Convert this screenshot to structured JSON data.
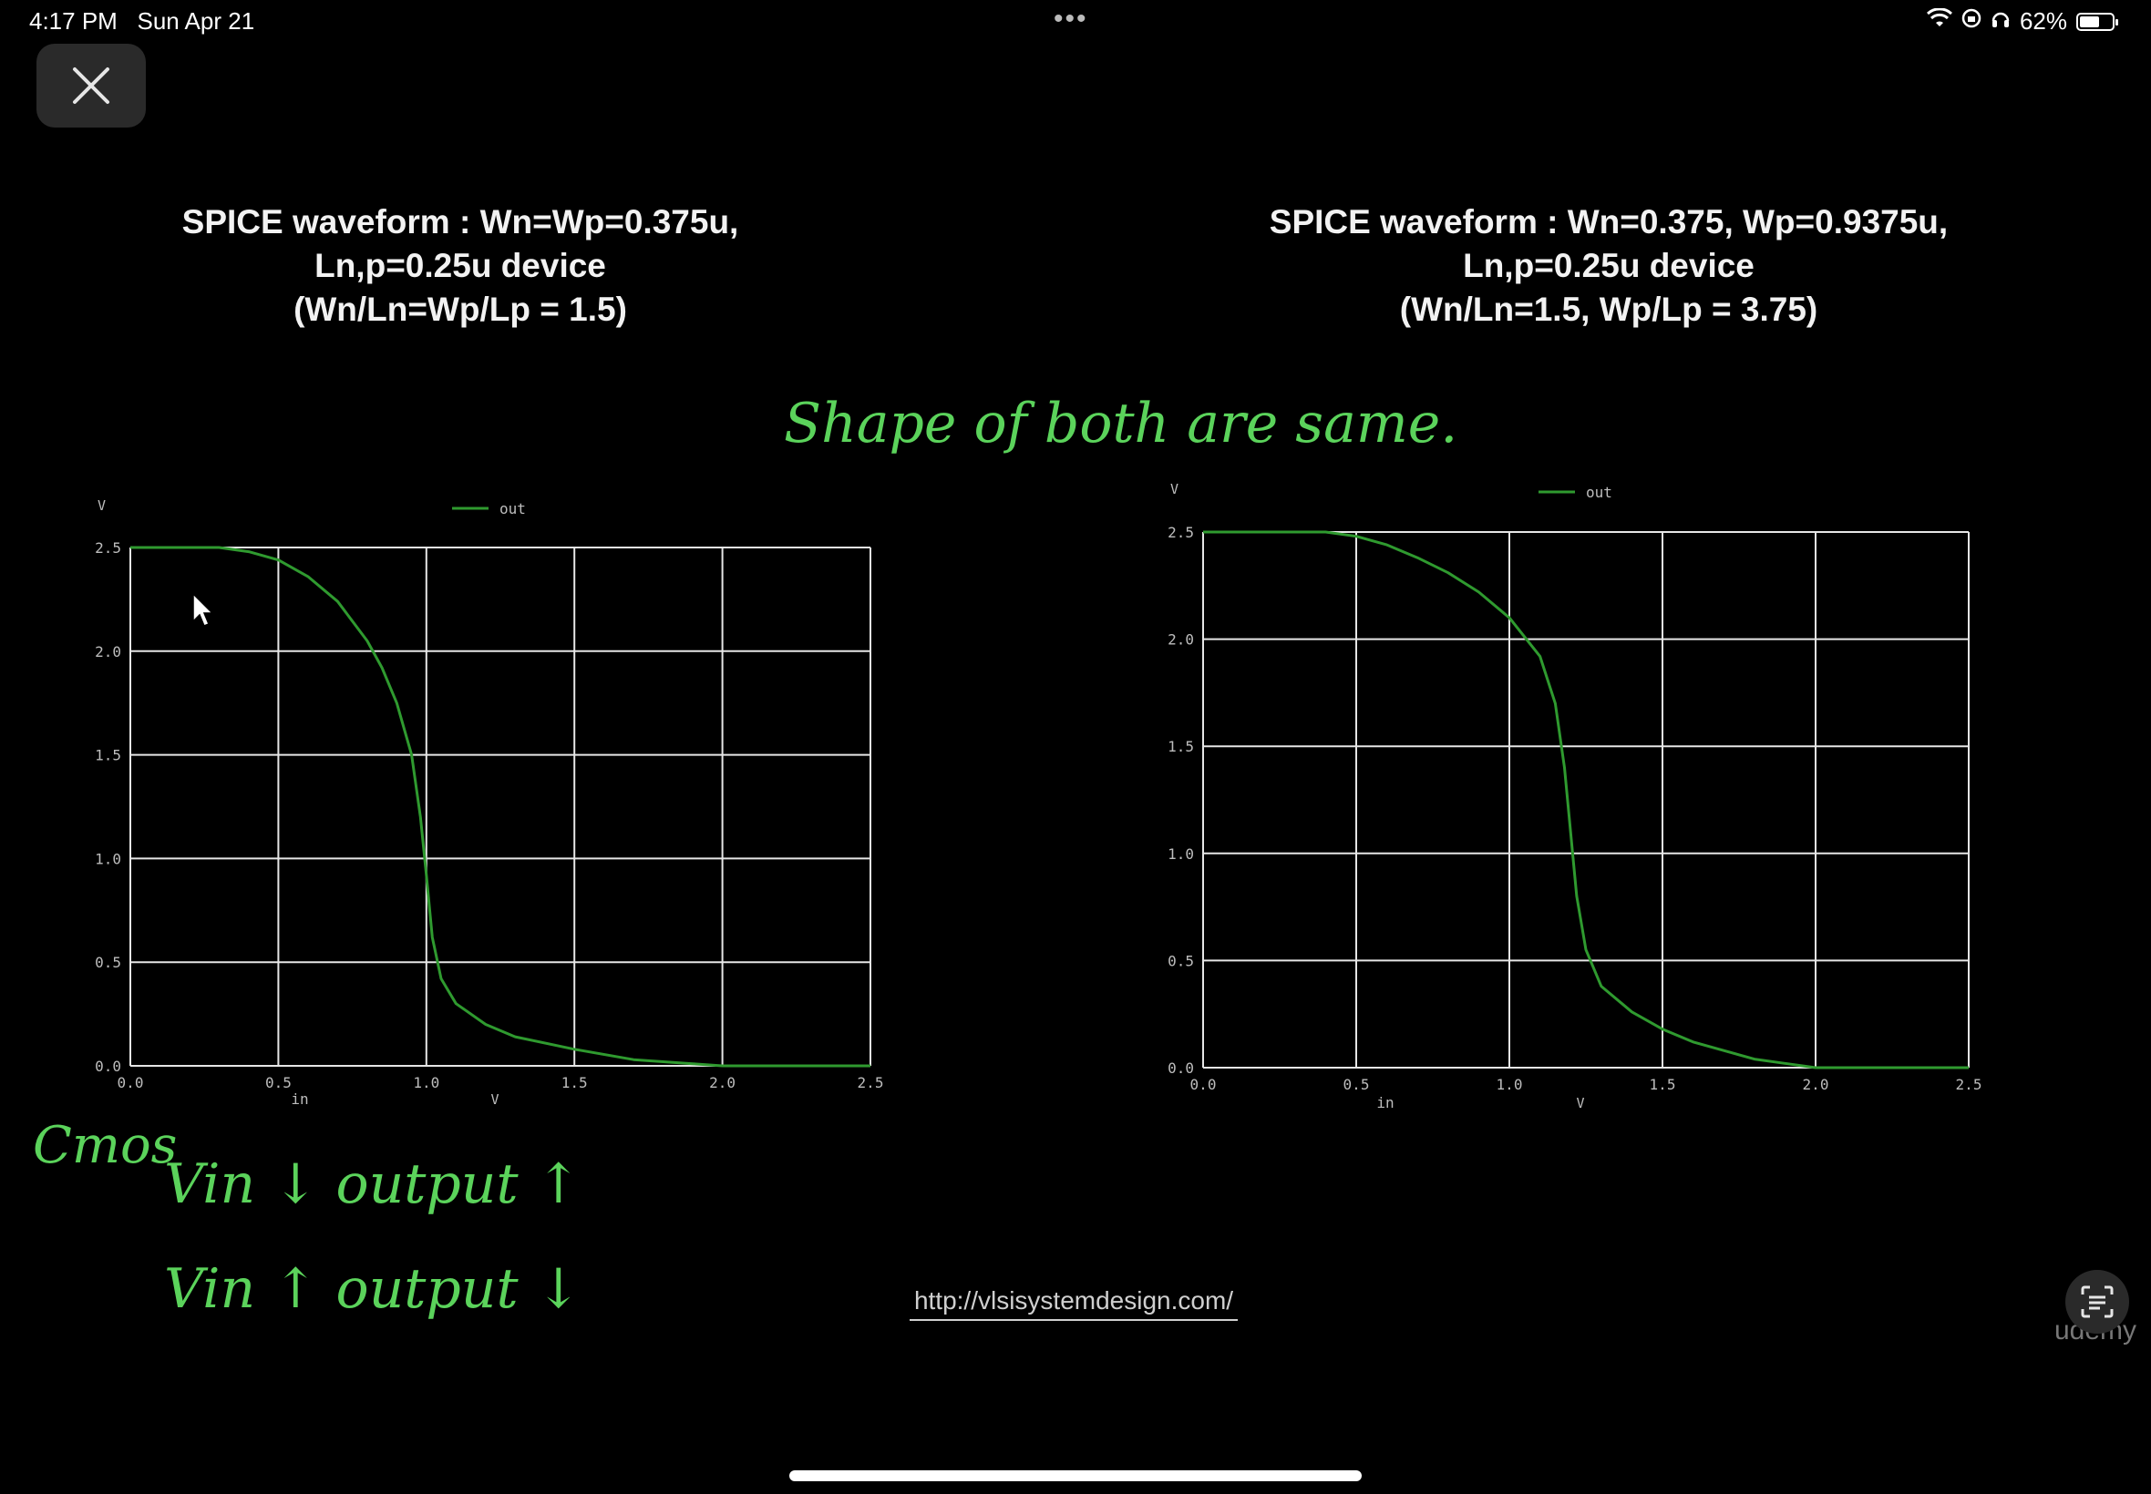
{
  "status_bar": {
    "time": "4:17 PM",
    "date": "Sun Apr 21",
    "battery": "62%",
    "battery_level": 0.62,
    "icons": [
      "wifi-icon",
      "lock-rotation-icon",
      "headphones-icon",
      "battery-icon"
    ]
  },
  "close_icon": "close-icon",
  "titles": {
    "left": [
      "SPICE waveform : Wn=Wp=0.375u,",
      "Ln,p=0.25u device",
      "(Wn/Ln=Wp/Lp = 1.5)"
    ],
    "right": [
      "SPICE waveform : Wn=0.375, Wp=0.9375u,",
      "Ln,p=0.25u device",
      "(Wn/Ln=1.5, Wp/Lp = 3.75)"
    ]
  },
  "annotations": {
    "top": "Shape of both are same.",
    "cmos": "Cmos",
    "line1": "Vin ↓   output ↑",
    "line2": "Vin ↑   output ↓"
  },
  "footer": {
    "link": "http://vlsisystemdesign.com/",
    "watermark": "udemy"
  },
  "colors": {
    "background": "#000000",
    "curve": "#2f9a2f",
    "grid": "#e6e6e6",
    "handwriting": "#5bd35b"
  },
  "chart_data": [
    {
      "type": "line",
      "title": "",
      "xlabel": "in",
      "xunit": "V",
      "ylabel": "V",
      "xlim": [
        0,
        2.5
      ],
      "ylim": [
        0,
        2.5
      ],
      "xticks": [
        "0.0",
        "0.5",
        "1.0",
        "1.5",
        "2.0",
        "2.5"
      ],
      "yticks": [
        "0.0",
        "0.5",
        "1.0",
        "1.5",
        "2.0",
        "2.5"
      ],
      "grid": true,
      "legend": "top-center",
      "series": [
        {
          "name": "out",
          "x": [
            0.0,
            0.3,
            0.4,
            0.5,
            0.6,
            0.7,
            0.8,
            0.85,
            0.9,
            0.95,
            0.98,
            1.0,
            1.02,
            1.05,
            1.1,
            1.2,
            1.3,
            1.5,
            1.7,
            1.9,
            2.0,
            2.5
          ],
          "y": [
            2.5,
            2.5,
            2.48,
            2.44,
            2.36,
            2.24,
            2.05,
            1.92,
            1.75,
            1.5,
            1.2,
            0.92,
            0.62,
            0.42,
            0.3,
            0.2,
            0.14,
            0.08,
            0.03,
            0.01,
            0.0,
            0.0
          ]
        }
      ]
    },
    {
      "type": "line",
      "title": "",
      "xlabel": "in",
      "xunit": "V",
      "ylabel": "V",
      "xlim": [
        0,
        2.5
      ],
      "ylim": [
        0,
        2.5
      ],
      "xticks": [
        "0.0",
        "0.5",
        "1.0",
        "1.5",
        "2.0",
        "2.5"
      ],
      "yticks": [
        "0.0",
        "0.5",
        "1.0",
        "1.5",
        "2.0",
        "2.5"
      ],
      "grid": true,
      "legend": "top-center",
      "series": [
        {
          "name": "out",
          "x": [
            0.0,
            0.4,
            0.5,
            0.6,
            0.7,
            0.8,
            0.9,
            1.0,
            1.1,
            1.15,
            1.18,
            1.2,
            1.22,
            1.25,
            1.3,
            1.4,
            1.5,
            1.6,
            1.7,
            1.8,
            1.9,
            2.0,
            2.5
          ],
          "y": [
            2.5,
            2.5,
            2.48,
            2.44,
            2.38,
            2.31,
            2.22,
            2.1,
            1.92,
            1.7,
            1.4,
            1.1,
            0.8,
            0.55,
            0.38,
            0.26,
            0.18,
            0.12,
            0.08,
            0.04,
            0.02,
            0.0,
            0.0
          ]
        }
      ]
    }
  ]
}
